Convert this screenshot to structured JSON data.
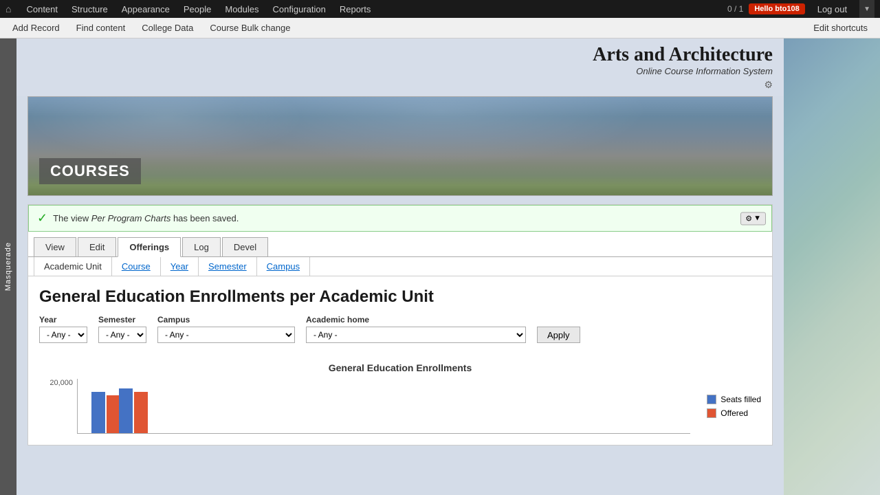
{
  "adminBar": {
    "homeIcon": "⌂",
    "navItems": [
      {
        "label": "Content",
        "id": "content"
      },
      {
        "label": "Structure",
        "id": "structure"
      },
      {
        "label": "Appearance",
        "id": "appearance"
      },
      {
        "label": "People",
        "id": "people"
      },
      {
        "label": "Modules",
        "id": "modules"
      },
      {
        "label": "Configuration",
        "id": "configuration"
      },
      {
        "label": "Reports",
        "id": "reports"
      }
    ],
    "counter": "0 / 1",
    "userBadge": "Hello bto108",
    "logoutLabel": "Log out",
    "dropdownArrow": "▼"
  },
  "secondaryNav": {
    "items": [
      {
        "label": "Add Record"
      },
      {
        "label": "Find content"
      },
      {
        "label": "College Data"
      },
      {
        "label": "Course Bulk change"
      }
    ],
    "editShortcuts": "Edit shortcuts"
  },
  "masquerade": {
    "text": "Masquerade"
  },
  "siteTitle": "Arts and Architecture",
  "siteSubtitle": "Online Course Information System",
  "heroLabel": "COURSES",
  "statusMessage": {
    "icon": "✓",
    "textBefore": "The view ",
    "linkText": "Per Program Charts",
    "textAfter": " has been saved.",
    "gearIcon": "⚙",
    "dropdownArrow": "▼"
  },
  "tabs": [
    {
      "label": "View",
      "active": false
    },
    {
      "label": "Edit",
      "active": false
    },
    {
      "label": "Offerings",
      "active": true
    },
    {
      "label": "Log",
      "active": false
    },
    {
      "label": "Devel",
      "active": false
    }
  ],
  "subtabs": [
    {
      "label": "Academic Unit",
      "active": true
    },
    {
      "label": "Course",
      "active": false
    },
    {
      "label": "Year",
      "active": false
    },
    {
      "label": "Semester",
      "active": false
    },
    {
      "label": "Campus",
      "active": false
    }
  ],
  "pageTitle": "General Education Enrollments per Academic Unit",
  "filters": {
    "year": {
      "label": "Year",
      "placeholder": "- Any -",
      "options": [
        "- Any -"
      ]
    },
    "semester": {
      "label": "Semester",
      "placeholder": "- Any -",
      "options": [
        "- Any -"
      ]
    },
    "campus": {
      "label": "Campus",
      "placeholder": "- Any -",
      "options": [
        "- Any -"
      ]
    },
    "academicHome": {
      "label": "Academic home",
      "placeholder": "- Any -",
      "options": [
        "- Any -"
      ]
    },
    "applyButton": "Apply"
  },
  "chart": {
    "title": "General Education Enrollments",
    "yLabel": "20,000",
    "legend": [
      {
        "color": "#4472c4",
        "label": "Seats filled"
      },
      {
        "color": "#e05533",
        "label": "Offered"
      }
    ],
    "bars": [
      {
        "blue": 60,
        "red": 55
      },
      {
        "blue": 65,
        "red": 60
      }
    ]
  }
}
